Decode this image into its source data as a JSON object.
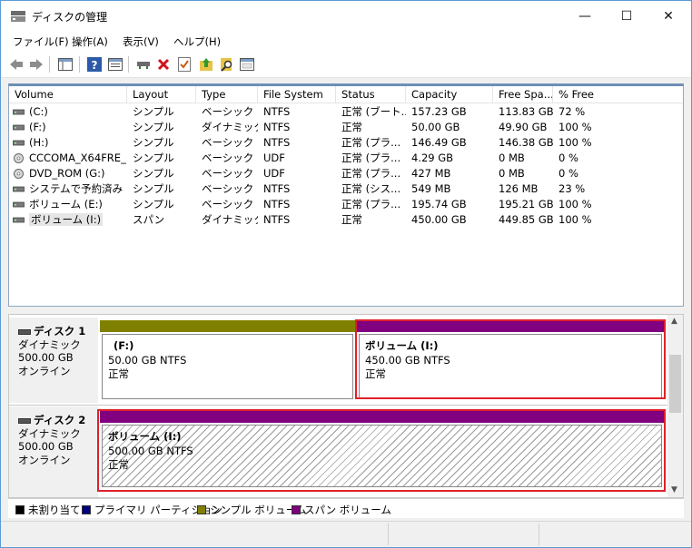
{
  "window": {
    "title": "ディスクの管理",
    "minimize": "—",
    "maximize": "☐",
    "close": "✕"
  },
  "menu": [
    "ファイル(F)",
    "操作(A)",
    "表示(V)",
    "ヘルプ(H)"
  ],
  "toolbar": [
    "back-arrow-icon",
    "forward-arrow-icon",
    "console-tree-icon",
    "help-icon",
    "properties-icon",
    "connect-drive-icon",
    "delete-icon",
    "check-icon",
    "up-folder-icon",
    "search-icon",
    "dialog-icon"
  ],
  "volume_table": {
    "headers": [
      "Volume",
      "Layout",
      "Type",
      "File System",
      "Status",
      "Capacity",
      "Free Spa...",
      "% Free"
    ],
    "rows": [
      {
        "volume": "(C:)",
        "layout": "シンプル",
        "type": "ベーシック",
        "fs": "NTFS",
        "status": "正常 (ブート...",
        "capacity": "157.23 GB",
        "free": "113.83 GB",
        "pct": "72 %",
        "icon": "hdd"
      },
      {
        "volume": "(F:)",
        "layout": "シンプル",
        "type": "ダイナミック",
        "fs": "NTFS",
        "status": "正常",
        "capacity": "50.00 GB",
        "free": "49.90 GB",
        "pct": "100 %",
        "icon": "hdd"
      },
      {
        "volume": "(H:)",
        "layout": "シンプル",
        "type": "ベーシック",
        "fs": "NTFS",
        "status": "正常 (プラ...",
        "capacity": "146.49 GB",
        "free": "146.38 GB",
        "pct": "100 %",
        "icon": "hdd"
      },
      {
        "volume": "CCCOMA_X64FRE_...",
        "layout": "シンプル",
        "type": "ベーシック",
        "fs": "UDF",
        "status": "正常 (プラ...",
        "capacity": "4.29 GB",
        "free": "0 MB",
        "pct": "0 %",
        "icon": "cd"
      },
      {
        "volume": "DVD_ROM (G:)",
        "layout": "シンプル",
        "type": "ベーシック",
        "fs": "UDF",
        "status": "正常 (プラ...",
        "capacity": "427 MB",
        "free": "0 MB",
        "pct": "0 %",
        "icon": "cd"
      },
      {
        "volume": "システムで予約済み",
        "layout": "シンプル",
        "type": "ベーシック",
        "fs": "NTFS",
        "status": "正常 (シス...",
        "capacity": "549 MB",
        "free": "126 MB",
        "pct": "23 %",
        "icon": "hdd"
      },
      {
        "volume": "ボリューム (E:)",
        "layout": "シンプル",
        "type": "ベーシック",
        "fs": "NTFS",
        "status": "正常 (プラ...",
        "capacity": "195.74 GB",
        "free": "195.21 GB",
        "pct": "100 %",
        "icon": "hdd"
      },
      {
        "volume": "ボリューム (I:)",
        "layout": "スパン",
        "type": "ダイナミック",
        "fs": "NTFS",
        "status": "正常",
        "capacity": "450.00 GB",
        "free": "449.85 GB",
        "pct": "100 %",
        "icon": "hdd"
      }
    ]
  },
  "disks": [
    {
      "name": "ディスク 1",
      "type": "ダイナミック",
      "size": "500.00 GB",
      "state": "オンライン",
      "partitions": [
        {
          "name": "(F:)",
          "size": "50.00 GB NTFS",
          "status": "正常",
          "color": "#808000",
          "selected": false
        },
        {
          "name": "ボリューム  (I:)",
          "size": "450.00 GB NTFS",
          "status": "正常",
          "color": "#800080",
          "selected": true
        }
      ]
    },
    {
      "name": "ディスク 2",
      "type": "ダイナミック",
      "size": "500.00 GB",
      "state": "オンライン",
      "partitions": [
        {
          "name": "ボリューム  (I:)",
          "size": "500.00 GB NTFS",
          "status": "正常",
          "color": "#800080",
          "selected": true
        }
      ]
    }
  ],
  "legend": [
    {
      "label": "未割り当て",
      "color": "#000000"
    },
    {
      "label": "プライマリ パーティション",
      "color": "#000080"
    },
    {
      "label": "シンプル ボリューム",
      "color": "#808000"
    },
    {
      "label": "スパン ボリューム",
      "color": "#800080"
    }
  ],
  "colors": {
    "selection_border": "#e0202a",
    "simple_volume": "#808000",
    "spanned_volume": "#800080"
  }
}
